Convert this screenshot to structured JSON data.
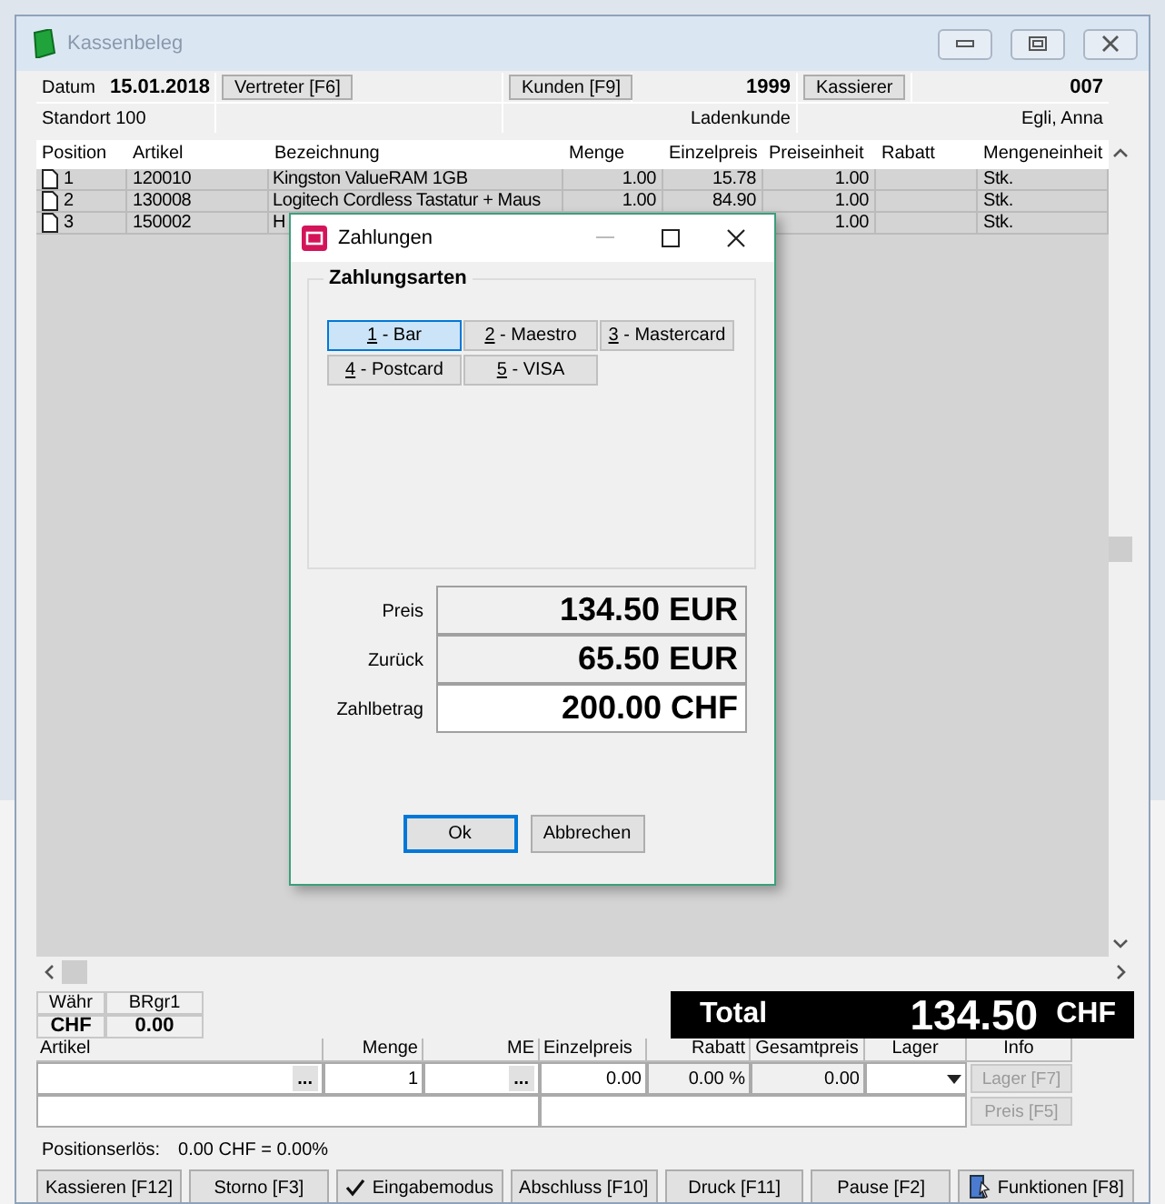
{
  "window": {
    "title": "Kassenbeleg"
  },
  "header": {
    "date_label": "Datum",
    "date": "15.01.2018",
    "vertreter_button": "Vertreter [F6]",
    "kunden_button": "Kunden [F9]",
    "kunden_nr": "1999",
    "kunden_name": "Ladenkunde",
    "kassierer_button": "Kassierer",
    "kassierer_nr": "007",
    "kassierer_name": "Egli, Anna",
    "standort": "Standort 100"
  },
  "table": {
    "columns": [
      "Position",
      "Artikel",
      "Bezeichnung",
      "Menge",
      "Einzelpreis",
      "Preiseinheit",
      "Rabatt",
      "Mengeneinheit"
    ],
    "rows": [
      {
        "cells": [
          "1",
          "120010",
          "Kingston ValueRAM 1GB",
          "1.00",
          "15.78",
          "1.00",
          "",
          "Stk."
        ]
      },
      {
        "cells": [
          "2",
          "130008",
          "Logitech Cordless Tastatur + Maus",
          "1.00",
          "84.90",
          "1.00",
          "",
          "Stk."
        ]
      },
      {
        "cells": [
          "3",
          "150002",
          "H",
          "",
          "",
          "1.00",
          "",
          "Stk."
        ]
      }
    ]
  },
  "dialog": {
    "title": "Zahlungen",
    "group_title": "Zahlungsarten",
    "payment_methods": [
      {
        "label": "1 - Bar",
        "selected": true
      },
      {
        "label": "2 - Maestro",
        "selected": false
      },
      {
        "label": "3 - Mastercard",
        "selected": false
      },
      {
        "label": "4 - Postcard",
        "selected": false
      },
      {
        "label": "5 - VISA",
        "selected": false
      }
    ],
    "amounts": [
      {
        "label": "Preis",
        "value": "134.50 EUR",
        "kind": "display"
      },
      {
        "label": "Zurück",
        "value": "65.50 EUR",
        "kind": "display"
      },
      {
        "label": "Zahlbetrag",
        "value": "200.00 CHF",
        "kind": "input"
      }
    ],
    "buttons": [
      {
        "label": "Ok",
        "selected": true
      },
      {
        "label": "Abbrechen",
        "selected": false
      }
    ]
  },
  "currency": {
    "headers": [
      "Währ",
      "BRgr1"
    ],
    "values": [
      "CHF",
      "0.00"
    ]
  },
  "total": {
    "label": "Total",
    "amount": "134.50",
    "currency": "CHF"
  },
  "entry": {
    "columns": [
      "Artikel",
      "Menge",
      "ME",
      "Einzelpreis",
      "Rabatt",
      "Gesamtpreis",
      "Lager",
      "Info"
    ],
    "ellipsis": "...",
    "menge": "1",
    "einzelpreis": "0.00",
    "rabatt": "0.00 %",
    "gesamtpreis": "0.00",
    "info_buttons": [
      {
        "label": "Lager [F7]",
        "disabled": true
      },
      {
        "label": "Preis [F5]",
        "disabled": true
      }
    ]
  },
  "status": {
    "label": "Positionserlös:",
    "value": "0.00 CHF = 0.00%"
  },
  "buttons": [
    {
      "label": "Kassieren [F12]",
      "kind": "plain"
    },
    {
      "label": "Storno [F3]",
      "kind": "plain"
    },
    {
      "label": "Eingabemodus",
      "kind": "check",
      "checked": true
    },
    {
      "label": "Abschluss [F10]",
      "kind": "plain"
    },
    {
      "label": "Druck [F11]",
      "kind": "plain"
    },
    {
      "label": "Pause [F2]",
      "kind": "plain"
    },
    {
      "label": "Funktionen [F8]",
      "kind": "icon"
    }
  ]
}
